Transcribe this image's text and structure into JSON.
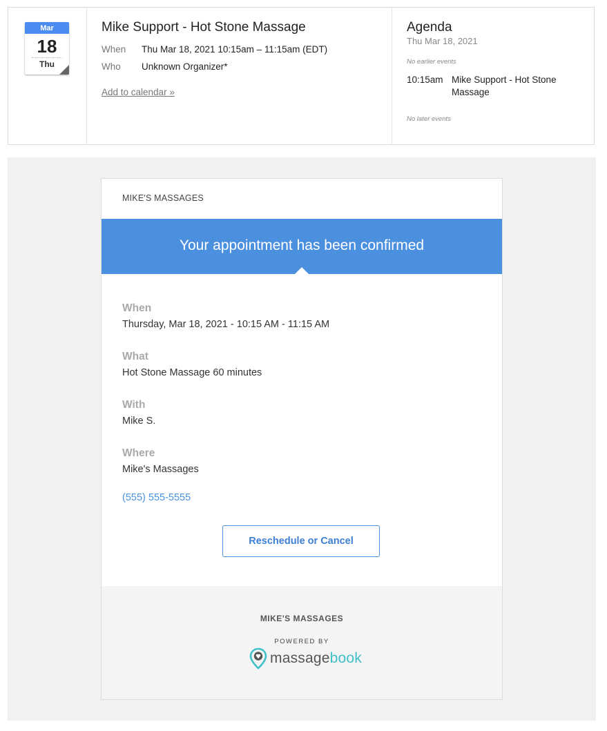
{
  "invite": {
    "cal_icon": {
      "month": "Mar",
      "day": "18",
      "weekday": "Thu"
    },
    "title": "Mike Support - Hot Stone Massage",
    "when_label": "When",
    "when_value": "Thu Mar 18, 2021 10:15am – 11:15am (EDT)",
    "who_label": "Who",
    "who_value": "Unknown Organizer*",
    "add_link": "Add to calendar »"
  },
  "agenda": {
    "title": "Agenda",
    "date": "Thu Mar 18, 2021",
    "no_earlier": "No earlier events",
    "event_time": "10:15am",
    "event_name": "Mike Support - Hot Stone Massage",
    "no_later": "No later events"
  },
  "email": {
    "business_name": "MIKE'S MASSAGES",
    "banner": "Your appointment has been confirmed",
    "when_label": "When",
    "when_value": "Thursday, Mar 18, 2021 - 10:15 AM - 11:15 AM",
    "what_label": "What",
    "what_value": "Hot Stone Massage 60 minutes",
    "with_label": "With",
    "with_value": "Mike S.",
    "where_label": "Where",
    "where_value": "Mike's Massages",
    "phone": "(555) 555-5555",
    "button_label": "Reschedule or Cancel",
    "footer_business": "MIKE'S MASSAGES",
    "powered_by": "POWERED BY",
    "logo_word_1": "massage",
    "logo_word_2": "book"
  },
  "colors": {
    "accent_blue": "#4b8fdf",
    "logo_teal": "#3fbfc6",
    "calendar_blue": "#4b8cf0"
  }
}
